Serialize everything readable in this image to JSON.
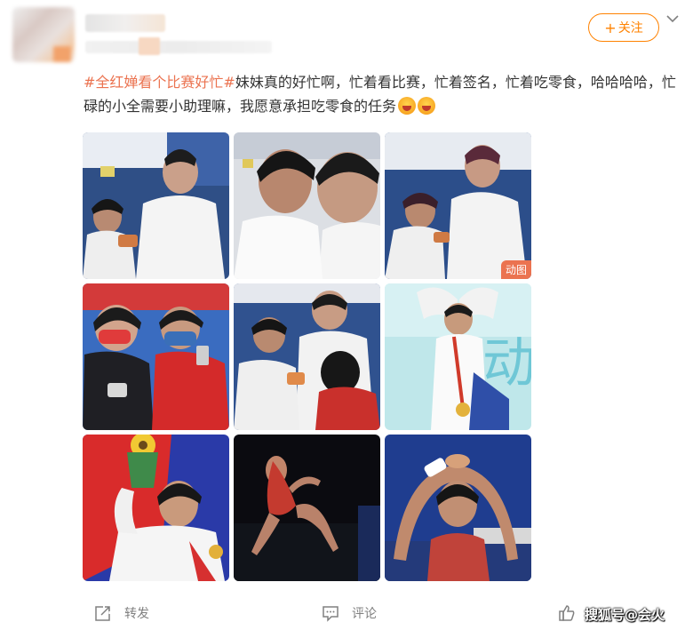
{
  "post": {
    "follow_label": "关注",
    "topic": "#全红婵看个比赛好忙#",
    "text": "妹妹真的好忙啊，忙着看比赛，忙着签名，忙着吃零食，哈哈哈哈，忙碌的小全需要小助理嘛，我愿意承担吃零食的任务",
    "emoji_names": [
      "laughing-emoji",
      "laughing-emoji"
    ]
  },
  "images": [
    {
      "name": "photo-1"
    },
    {
      "name": "photo-2"
    },
    {
      "name": "photo-3",
      "badge": "动图"
    },
    {
      "name": "photo-4"
    },
    {
      "name": "photo-5"
    },
    {
      "name": "photo-6"
    },
    {
      "name": "photo-7"
    },
    {
      "name": "photo-8"
    },
    {
      "name": "photo-9"
    }
  ],
  "footer": {
    "repost_label": "转发",
    "comment_label": "评论",
    "watermark": "搜狐号@会火"
  },
  "colors": {
    "accent": "#ff8200",
    "topic": "#eb7350",
    "footer_text": "#808080"
  }
}
